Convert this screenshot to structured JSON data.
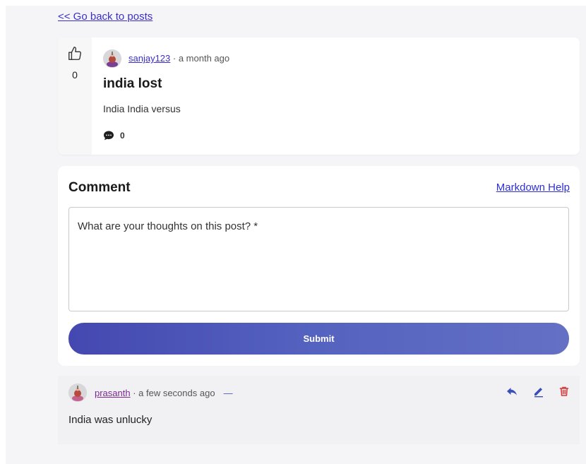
{
  "nav": {
    "back_label": "<< Go back to posts"
  },
  "post": {
    "votes": "0",
    "author": "sanjay123",
    "time": " · a month ago",
    "title": "india lost",
    "body": "India India versus",
    "comment_count": "0"
  },
  "comment_form": {
    "heading": "Comment",
    "markdown_help_label": "Markdown Help",
    "placeholder": "What are your thoughts on this post? *",
    "value": "",
    "submit_label": "Submit"
  },
  "comments": [
    {
      "author": "prasanth",
      "time": " · a few seconds ago",
      "collapse_label": "—",
      "text": "India was unlucky"
    }
  ],
  "icons": {
    "like": "thumbs-up-icon",
    "comment": "comment-bubble-icon",
    "reply": "reply-icon",
    "edit": "pencil-icon",
    "delete": "trash-icon",
    "avatar": "avatar-icon"
  },
  "colors": {
    "link": "#3b2fc9",
    "visited_link": "#7b2a8e",
    "submit_start": "#4448b0",
    "submit_end": "#6470c4",
    "delete": "#d63a3a",
    "action": "#3a4fb5"
  }
}
